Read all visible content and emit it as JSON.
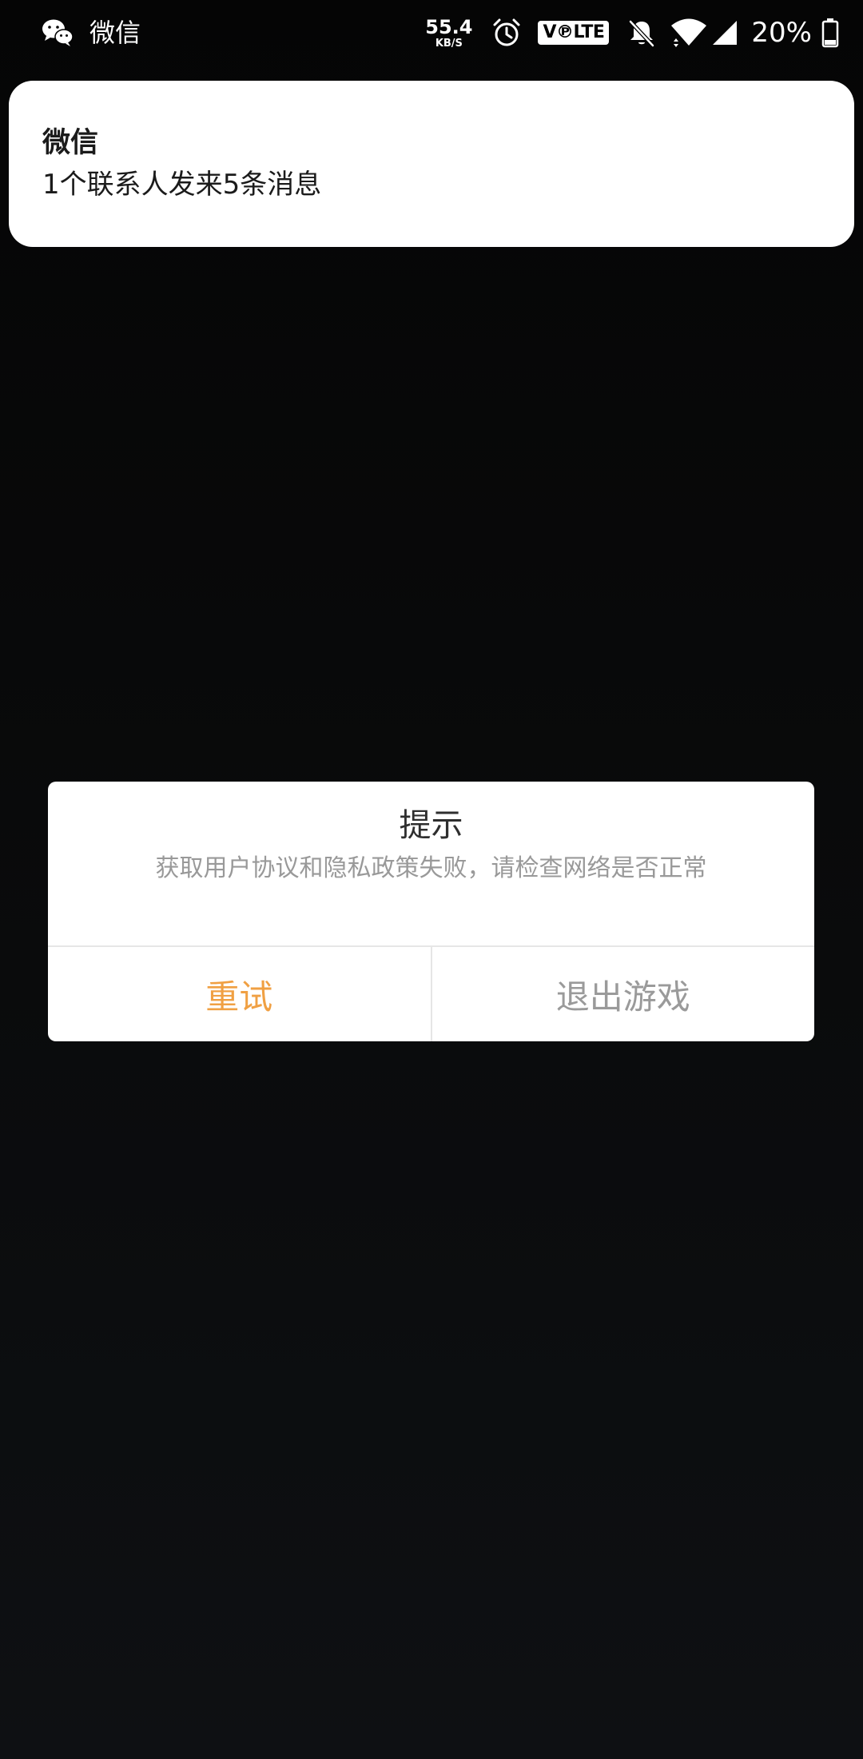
{
  "status_bar": {
    "app_name": "微信",
    "app_icon": "wechat-icon",
    "net_speed_value": "55.4",
    "net_speed_unit": "KB/S",
    "volte_label": "V℗LTE",
    "battery_percent": "20%",
    "icons": [
      "alarm-icon",
      "bell-off-icon",
      "wifi-icon",
      "signal-icon",
      "battery-icon"
    ]
  },
  "notification": {
    "title": "微信",
    "body": "1个联系人发来5条消息"
  },
  "dialog": {
    "title": "提示",
    "message": "获取用户协议和隐私政策失败，请检查网络是否正常",
    "retry_label": "重试",
    "exit_label": "退出游戏"
  },
  "colors": {
    "accent": "#f0a043",
    "secondary_text": "#999999",
    "background": "#0a0b0c"
  }
}
